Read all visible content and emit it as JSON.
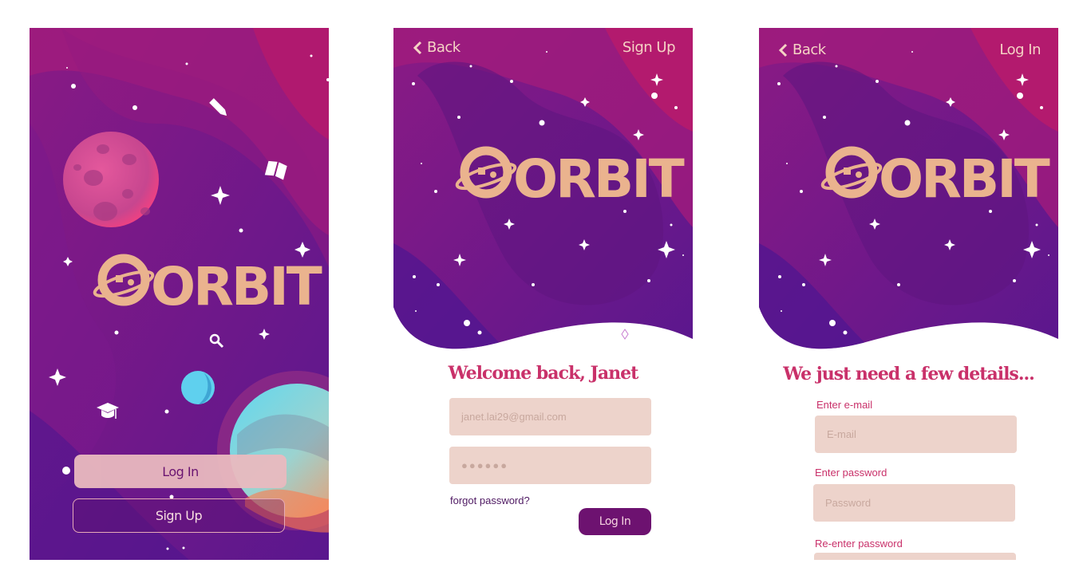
{
  "welcome": {
    "login_label": "Log In",
    "signup_label": "Sign Up"
  },
  "login": {
    "back_label": "Back",
    "nav_right_label": "Sign Up",
    "heading": "Welcome back, Janet",
    "email_value": "janet.lai29@gmail.com",
    "password_value": "●●●●●●",
    "forgot_label": "forgot password?",
    "submit_label": "Log In"
  },
  "signup": {
    "back_label": "Back",
    "nav_right_label": "Log In",
    "heading": "We just need a few details...",
    "email_label": "Enter e-mail",
    "email_placeholder": "E-mail",
    "password_label": "Enter password",
    "password_placeholder": "Password",
    "reenter_label": "Re-enter password"
  },
  "brand": {
    "logo_text": "ORBIT",
    "colors": {
      "accent": "#c9316a",
      "deep_purple": "#6d1270",
      "field_bg": "#edd3cb",
      "logo": "#eab38e"
    }
  },
  "icons": [
    "pencil-icon",
    "book-icon",
    "search-icon",
    "graduation-cap-icon",
    "chevron-left-icon",
    "sparkle-icon"
  ]
}
